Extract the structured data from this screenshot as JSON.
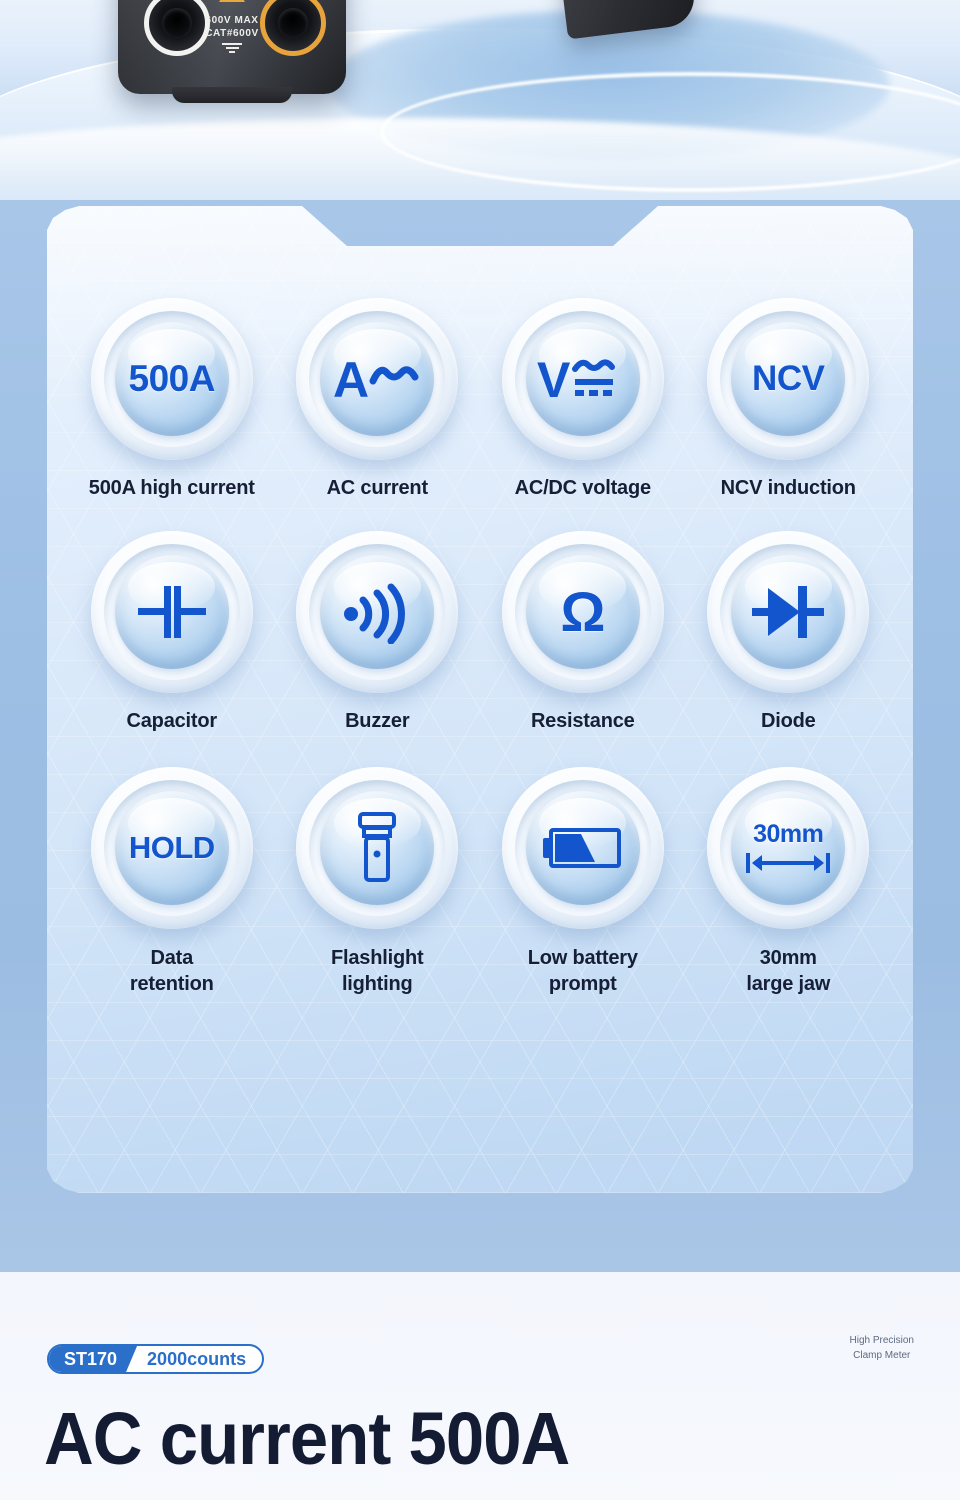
{
  "hero": {
    "device_warning_icon": "warning-triangle-icon",
    "voltage_rating_line1": "600V MAX",
    "voltage_rating_line2": "CAT#600V",
    "ground_icon": "earth-ground-icon"
  },
  "features": {
    "rows": [
      {
        "cells": [
          {
            "icon": "500a-current-icon",
            "glyph_text": "500A",
            "label": "500A high current"
          },
          {
            "icon": "ac-current-icon",
            "glyph_text": "A~",
            "label": "AC current"
          },
          {
            "icon": "ac-dc-voltage-icon",
            "glyph_text": "V",
            "label": "AC/DC voltage"
          },
          {
            "icon": "ncv-icon",
            "glyph_text": "NCV",
            "label": "NCV induction"
          }
        ]
      },
      {
        "cells": [
          {
            "icon": "capacitor-icon",
            "glyph_text": "",
            "label": "Capacitor"
          },
          {
            "icon": "buzzer-icon",
            "glyph_text": "",
            "label": "Buzzer"
          },
          {
            "icon": "resistance-ohm-icon",
            "glyph_text": "Ω",
            "label": "Resistance"
          },
          {
            "icon": "diode-icon",
            "glyph_text": "",
            "label": "Diode"
          }
        ]
      },
      {
        "cells": [
          {
            "icon": "data-hold-icon",
            "glyph_text": "HOLD",
            "label": "Data\nretention"
          },
          {
            "icon": "flashlight-icon",
            "glyph_text": "",
            "label": "Flashlight\nlighting"
          },
          {
            "icon": "low-battery-icon",
            "glyph_text": "",
            "label": "Low battery\nprompt"
          },
          {
            "icon": "jaw-size-icon",
            "glyph_text": "30mm",
            "label": "30mm\nlarge jaw"
          }
        ]
      }
    ]
  },
  "bottom": {
    "model": "ST170",
    "counts": "2000counts",
    "tagline_line1": "High Precision",
    "tagline_line2": "Clamp Meter",
    "headline": "AC current 500A"
  },
  "colors": {
    "accent_blue": "#2a6fc9",
    "glyph_blue": "#1355cc",
    "label_navy": "#161f36",
    "panel_light": "#eaf3fd",
    "backdrop_blue": "#a8c6e8"
  }
}
